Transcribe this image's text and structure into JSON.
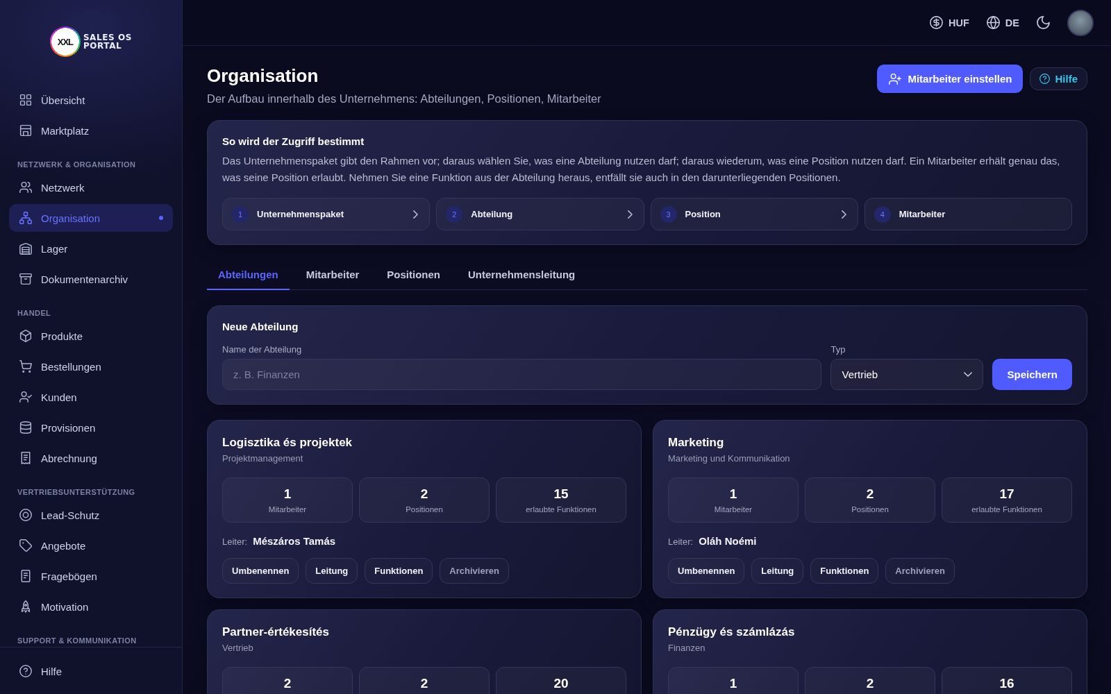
{
  "sidebar": {
    "logo": {
      "mark": "XXL",
      "title": "SALES OS",
      "subtitle": "PORTAL"
    },
    "sections": [
      {
        "items": [
          {
            "label": "Übersicht",
            "selected": false
          },
          {
            "label": "Marktplatz",
            "selected": false
          }
        ]
      },
      {
        "heading": "NETZWERK & ORGANISATION",
        "items": [
          {
            "label": "Netzwerk",
            "selected": false
          },
          {
            "label": "Organisation",
            "selected": true
          },
          {
            "label": "Lager",
            "selected": false
          },
          {
            "label": "Dokumentenarchiv",
            "selected": false
          }
        ]
      },
      {
        "heading": "HANDEL",
        "items": [
          {
            "label": "Produkte",
            "selected": false
          },
          {
            "label": "Bestellungen",
            "selected": false
          },
          {
            "label": "Kunden",
            "selected": false
          },
          {
            "label": "Provisionen",
            "selected": false
          },
          {
            "label": "Abrechnung",
            "selected": false
          }
        ]
      },
      {
        "heading": "VERTRIEBSUNTERSTÜTZUNG",
        "items": [
          {
            "label": "Lead-Schutz",
            "selected": false
          },
          {
            "label": "Angebote",
            "selected": false
          },
          {
            "label": "Fragebögen",
            "selected": false
          },
          {
            "label": "Motivation",
            "selected": false
          }
        ]
      },
      {
        "heading": "SUPPORT & KOMMUNIKATION"
      }
    ],
    "footer": {
      "label": "Hilfe"
    }
  },
  "top_bar": {
    "currency": "HUF",
    "language": "DE"
  },
  "header": {
    "title": "Organisation",
    "subtitle": "Der Aufbau innerhalb des Unternehmens: Abteilungen, Positionen, Mitarbeiter",
    "actions": [
      {
        "label": "Mitarbeiter einstellen",
        "kind": "primary"
      },
      {
        "label": "Hilfe",
        "kind": "help"
      }
    ]
  },
  "access_info": {
    "title": "So wird der Zugriff bestimmt",
    "text": "Das Unternehmenspaket gibt den Rahmen vor; daraus wählen Sie, was eine Abteilung nutzen darf; daraus wiederum, was eine Position nutzen darf. Ein Mitarbeiter erhält genau das, was seine Position erlaubt. Nehmen Sie eine Funktion aus der Abteilung heraus, entfällt sie auch in den darunterliegenden Positionen.",
    "steps": [
      {
        "number": "1",
        "label": "Unternehmenspaket"
      },
      {
        "number": "2",
        "label": "Abteilung"
      },
      {
        "number": "3",
        "label": "Position"
      },
      {
        "number": "4",
        "label": "Mitarbeiter"
      }
    ]
  },
  "tabs": [
    {
      "label": "Abteilungen",
      "selected": true
    },
    {
      "label": "Mitarbeiter",
      "selected": false
    },
    {
      "label": "Positionen",
      "selected": false
    },
    {
      "label": "Unternehmensleitung",
      "selected": false
    }
  ],
  "new_department": {
    "title": "Neue Abteilung",
    "name_field": {
      "label": "Name der Abteilung",
      "placeholder": "z. B. Finanzen"
    },
    "type_field": {
      "label": "Typ",
      "value": "Vertrieb"
    },
    "submit": "Speichern"
  },
  "departments": [
    {
      "name": "Logisztika és projektek",
      "type": "Projektmanagement",
      "stats": [
        {
          "value": "1",
          "label": "Mitarbeiter"
        },
        {
          "value": "2",
          "label": "Positionen"
        },
        {
          "value": "15",
          "label": "erlaubte Funktionen"
        }
      ],
      "leader_label": "Leiter:",
      "leader": "Mészáros Tamás",
      "actions": [
        {
          "label": "Umbenennen",
          "kind": "default"
        },
        {
          "label": "Leitung",
          "kind": "default"
        },
        {
          "label": "Funktionen",
          "kind": "default"
        },
        {
          "label": "Archivieren",
          "kind": "muted"
        }
      ]
    },
    {
      "name": "Marketing",
      "type": "Marketing und Kommunikation",
      "stats": [
        {
          "value": "1",
          "label": "Mitarbeiter"
        },
        {
          "value": "2",
          "label": "Positionen"
        },
        {
          "value": "17",
          "label": "erlaubte Funktionen"
        }
      ],
      "leader_label": "Leiter:",
      "leader": "Oláh Noémi",
      "actions": [
        {
          "label": "Umbenennen",
          "kind": "default"
        },
        {
          "label": "Leitung",
          "kind": "default"
        },
        {
          "label": "Funktionen",
          "kind": "default"
        },
        {
          "label": "Archivieren",
          "kind": "muted"
        }
      ]
    },
    {
      "name": "Partner-értékesítés",
      "type": "Vertrieb",
      "stats": [
        {
          "value": "2"
        },
        {
          "value": "2"
        },
        {
          "value": "20"
        }
      ]
    },
    {
      "name": "Pénzügy és számlázás",
      "type": "Finanzen",
      "stats": [
        {
          "value": "1"
        },
        {
          "value": "2"
        },
        {
          "value": "16"
        }
      ]
    }
  ]
}
